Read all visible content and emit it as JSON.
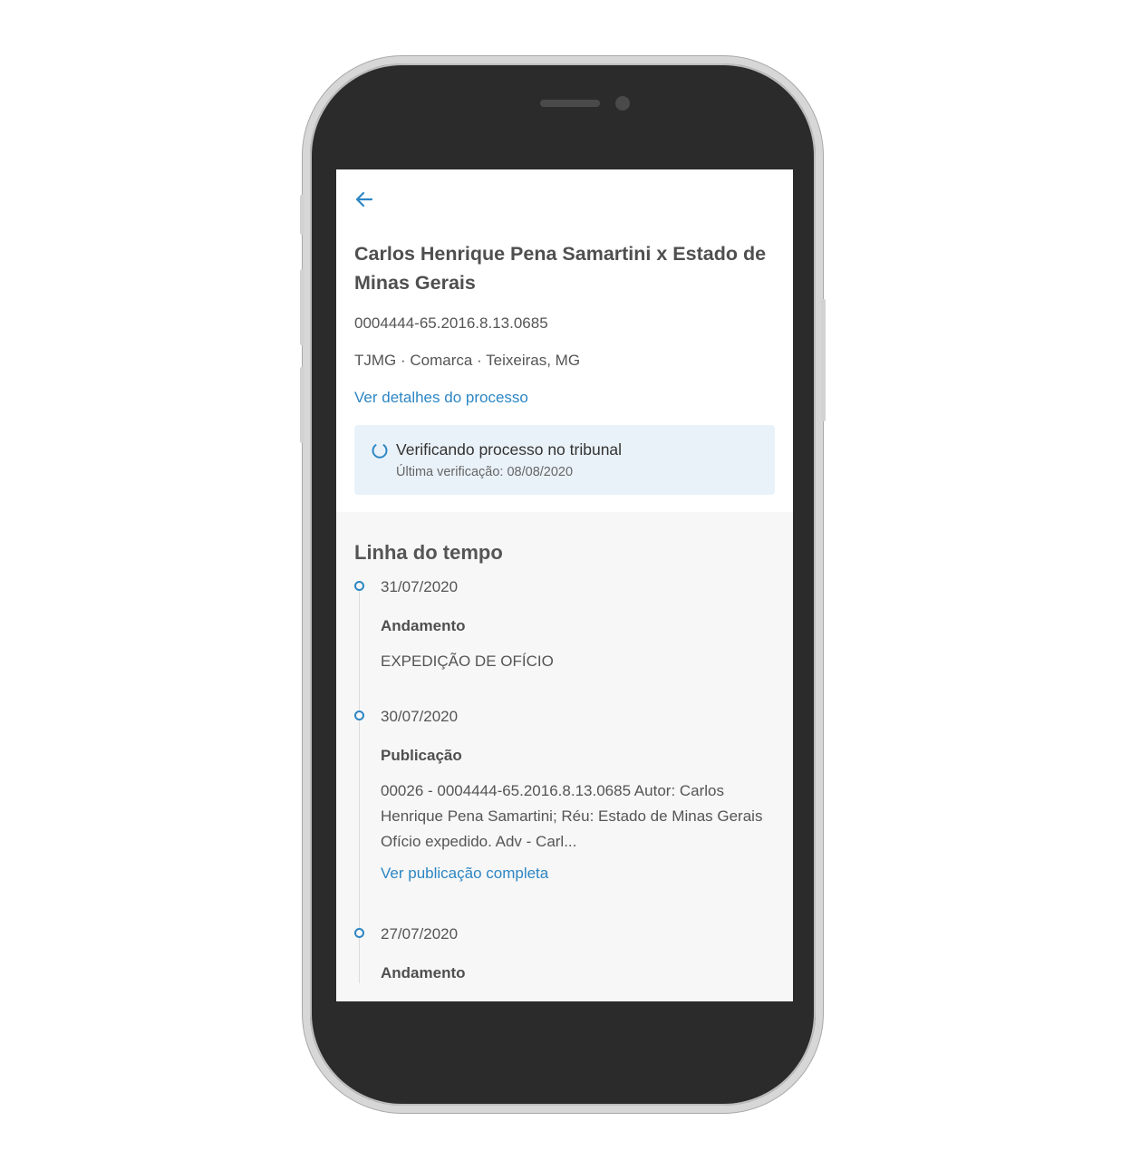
{
  "header": {
    "title": "Carlos Henrique Pena Samartini x Estado de Minas Gerais",
    "process_number": "0004444-65.2016.8.13.0685",
    "court": "TJMG · Comarca · Teixeiras, MG",
    "details_link": "Ver detalhes do processo"
  },
  "verification": {
    "title": "Verificando processo no tribunal",
    "subtitle": "Última verificação: 08/08/2020"
  },
  "timeline": {
    "heading": "Linha do tempo",
    "items": [
      {
        "date": "31/07/2020",
        "type": "Andamento",
        "text": "EXPEDIÇÃO DE OFÍCIO"
      },
      {
        "date": "30/07/2020",
        "type": "Publicação",
        "text": "00026 - 0004444-65.2016.8.13.0685 Autor: Carlos Henrique Pena Samartini; Réu: Estado de Minas Gerais Ofício expedido. Adv - Carl...",
        "link": "Ver publicação completa"
      },
      {
        "date": "27/07/2020",
        "type": "Andamento"
      }
    ]
  },
  "colors": {
    "accent": "#2d86c4",
    "status_bg": "#eaf2f9",
    "phone_body": "#2b2b2b",
    "phone_frame": "#d7d7d7"
  },
  "icons": {
    "back": "arrow-left-icon",
    "status": "spinner-icon",
    "timeline_marker": "timeline-dot-icon"
  }
}
